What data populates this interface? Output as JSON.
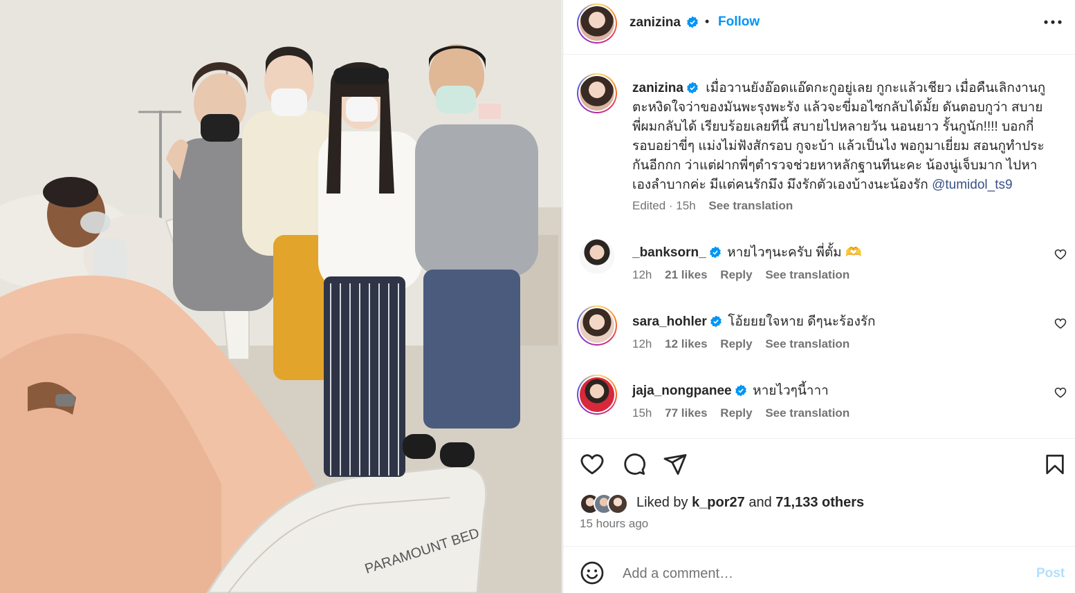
{
  "post": {
    "author": "zanizina",
    "follow_label": "Follow",
    "dot": "•",
    "more_icon": "more-horizontal-icon",
    "caption": "เมื่อวานยังอ๊อดแอ๊ดกะกูอยู่เลย กูกะแล้วเชียว เมื่อคืนเลิกงานกูตะหงิดใจว่าของมันพะรุงพะรัง แล้วจะขี่มอไซกลับได้มั้ย ดันตอบกูว่า สบาย พี่ผมกลับได้ เรียบร้อยเลยทีนี้ สบายไปหลายวัน นอนยาว รั้นกูนัก!!!! บอกกี่รอบอย่าขี่ๆ แม่งไม่ฟังสักรอบ กูจะบ้า แล้วเป็นไง พอกูมาเยี่ยม สอนกูทำประกันอีกกก ว่าแต่ฝากพี่ๆตำรวจช่วยหาหลักฐานทีนะคะ น้องนู่เจ็บมาก ไปหาเองลำบากค่ะ มีแต่คนรักมึง มึงรักตัวเองบ้างนะน้องรัก",
    "caption_lines": [
      "เมื่อวานยังอ๊อดแอ๊ดกะกูอยู่เลย กูกะแล้วเชียว เมื่อคืนเลิกงานกู",
      "ตะหงิดใจว่าของมันพะรุงพะรัง แล้วจะขี่มอไซกลับได้มั้ย ดันตอบกูว่า สบาย",
      "พี่ผมกลับได้ เรียบร้อยเลยทีนี้ สบายไปหลายวัน นอนยาว รั้นกูนัก!!!! บอกกี่",
      "รอบอย่าขี่ๆ แม่งไม่ฟังสักรอบ กูจะบ้า แล้วเป็นไง พอกูมาเยี่ยม สอนกูทำประ",
      "กันอีกกก ว่าแต่ฝากพี่ๆตำรวจช่วยหาหลักฐานทีนะคะ น้องนู่เจ็บมาก ไปหา",
      "เองลำบากค่ะ มีแต่คนรักมึง มึงรักตัวเองบ้างนะน้องรัก "
    ],
    "mention": "@tumidol_ts9",
    "edited_label": "Edited · 15h",
    "see_translation": "See translation"
  },
  "comments": [
    {
      "user": "_banksorn_",
      "text": "หายไวๆนะครับ พี่ตั้ม 🫶",
      "time": "12h",
      "likes": "21 likes",
      "reply": "Reply",
      "translate": "See translation"
    },
    {
      "user": "sara_hohler",
      "text": "โอ้ยยยใจหาย ดีๆนะร้องรัก",
      "time": "12h",
      "likes": "12 likes",
      "reply": "Reply",
      "translate": "See translation"
    },
    {
      "user": "jaja_nongpanee",
      "text": "หายไวๆนี้าาา",
      "time": "15h",
      "likes": "77 likes",
      "reply": "Reply",
      "translate": "See translation"
    }
  ],
  "actions": {
    "icons": [
      "heart-icon",
      "comment-icon",
      "share-icon",
      "bookmark-icon"
    ]
  },
  "likes": {
    "prefix": "Liked by ",
    "user": "k_por27",
    "middle": " and ",
    "others": "71,133 others"
  },
  "timestamp": "15 hours ago",
  "add_comment": {
    "placeholder": "Add a comment…",
    "post_label": "Post",
    "emoji_icon": "emoji-icon"
  },
  "photo": {
    "bed_brand": "PARAMOUNT BED"
  },
  "colors": {
    "accent": "#0095f6",
    "verified": "#0095f6",
    "muted": "#737373",
    "text": "#262626",
    "mention": "#385185",
    "post_disabled": "#b2dffc"
  }
}
